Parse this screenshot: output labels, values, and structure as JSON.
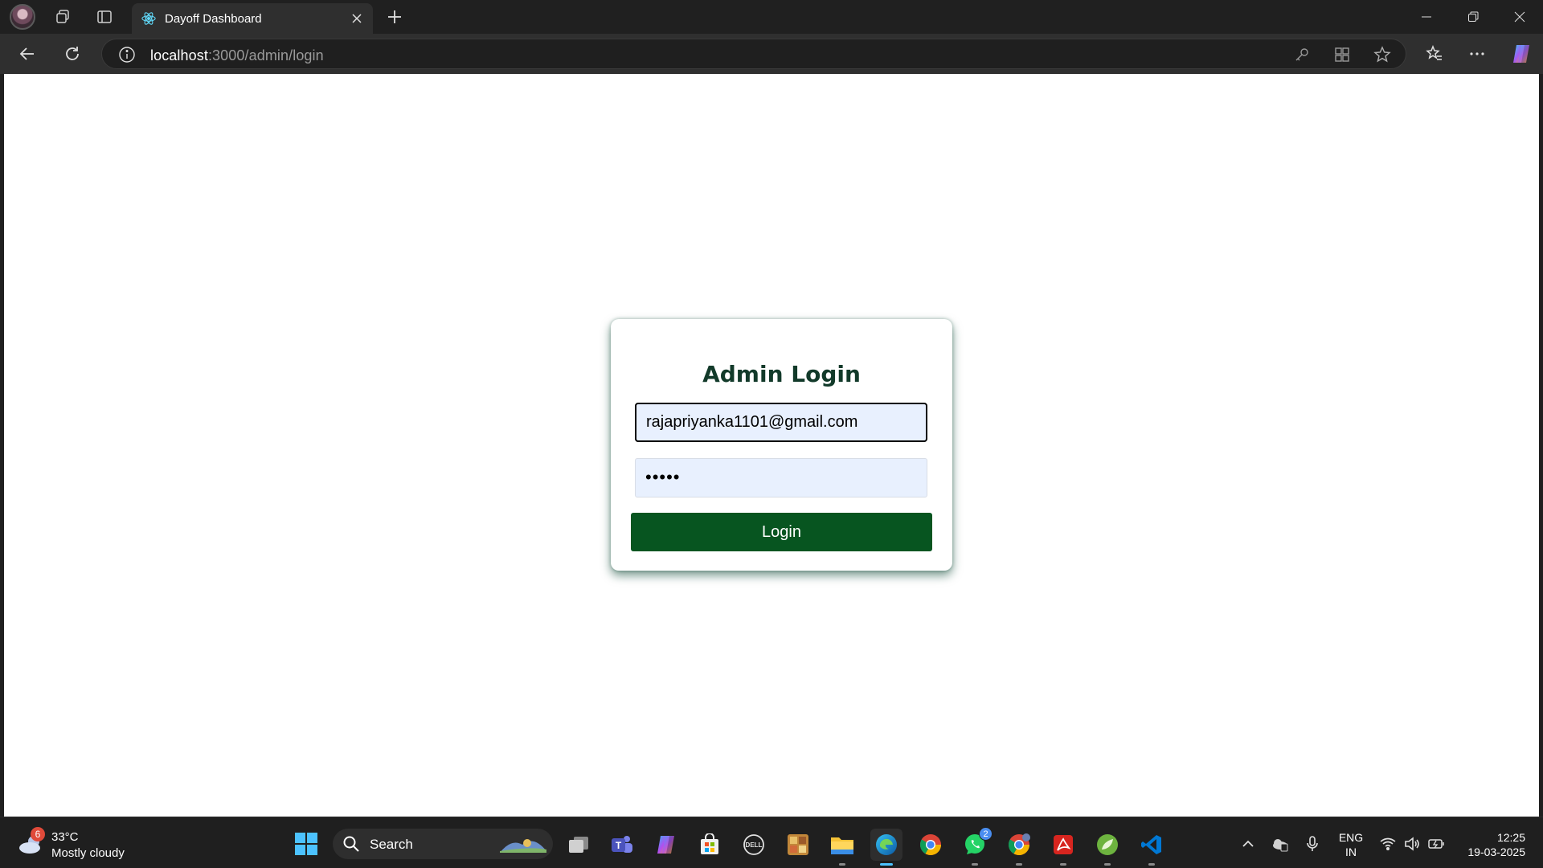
{
  "browser": {
    "tab_title": "Dayoff Dashboard",
    "url_host": "localhost",
    "url_path": ":3000/admin/login"
  },
  "login": {
    "title": "Admin Login",
    "email_value": "rajapriyanka1101@gmail.com",
    "password_mask": "•••••",
    "button_label": "Login"
  },
  "colors": {
    "accent": "#075520",
    "title_color": "#123a2a",
    "input_bg": "#e8f0fe"
  },
  "taskbar": {
    "weather_badge": "6",
    "weather_temp": "33°C",
    "weather_desc": "Mostly cloudy",
    "search_label": "Search",
    "whatsapp_badge": "2",
    "lang_line1": "ENG",
    "lang_line2": "IN",
    "time": "12:25",
    "date": "19-03-2025"
  }
}
